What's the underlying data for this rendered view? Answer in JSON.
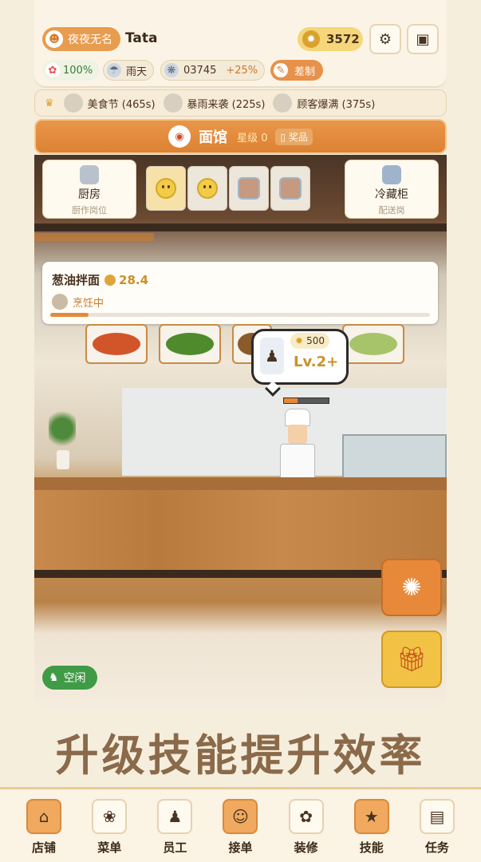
{
  "header": {
    "badge_label": "夜夜无名",
    "player_name": "Tata",
    "coins": "3572",
    "satisfaction": "100%",
    "weather": "雨天",
    "gems": "03745",
    "gems_bonus": "+25%",
    "review_label": "差制"
  },
  "events": [
    {
      "label": "美食节 (465s)"
    },
    {
      "label": "暴雨来袭 (225s)"
    },
    {
      "label": "顾客爆满 (375s)"
    }
  ],
  "shop": {
    "name": "面馆",
    "star_level": "星级 0",
    "award_label": "奖品"
  },
  "stations": {
    "kitchen": {
      "name": "厨房",
      "sub": "厨作岗位"
    },
    "fridge": {
      "name": "冷藏柜",
      "sub": "配送岗"
    }
  },
  "order": {
    "dish": "葱油拌面",
    "price": "28.4",
    "status": "烹饪中",
    "progress": 0.1
  },
  "bubble": {
    "cost": "500",
    "level": "Lv.2+"
  },
  "idle_label": "空闲",
  "slogan": "升级技能提升效率",
  "nav": [
    {
      "label": "店铺",
      "icon": "store-icon"
    },
    {
      "label": "菜单",
      "icon": "menu-icon"
    },
    {
      "label": "员工",
      "icon": "staff-icon"
    },
    {
      "label": "接单",
      "icon": "order-icon"
    },
    {
      "label": "装修",
      "icon": "decor-icon"
    },
    {
      "label": "技能",
      "icon": "skill-icon"
    },
    {
      "label": "任务",
      "icon": "task-icon"
    }
  ],
  "colors": {
    "accent": "#dd8233",
    "price_gold": "#c9912a",
    "idle_green": "#3f9b45"
  }
}
